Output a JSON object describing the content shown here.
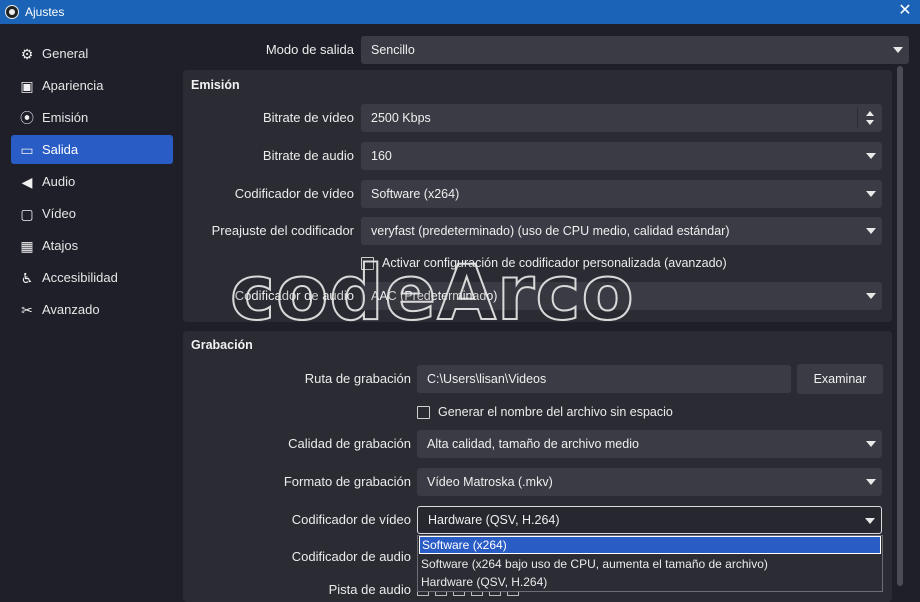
{
  "window": {
    "title": "Ajustes"
  },
  "sidebar": {
    "items": [
      {
        "label": "General",
        "icon": "gear-icon"
      },
      {
        "label": "Apariencia",
        "icon": "appearance-icon"
      },
      {
        "label": "Emisión",
        "icon": "broadcast-icon"
      },
      {
        "label": "Salida",
        "icon": "output-icon",
        "active": true
      },
      {
        "label": "Audio",
        "icon": "speaker-icon"
      },
      {
        "label": "Vídeo",
        "icon": "monitor-icon"
      },
      {
        "label": "Atajos",
        "icon": "keyboard-icon"
      },
      {
        "label": "Accesibilidad",
        "icon": "accessibility-icon"
      },
      {
        "label": "Avanzado",
        "icon": "tools-icon"
      }
    ]
  },
  "output_mode": {
    "label": "Modo de salida",
    "value": "Sencillo"
  },
  "streaming": {
    "title": "Emisión",
    "video_bitrate": {
      "label": "Bitrate de vídeo",
      "value": "2500 Kbps"
    },
    "audio_bitrate": {
      "label": "Bitrate de audio",
      "value": "160"
    },
    "video_encoder": {
      "label": "Codificador de vídeo",
      "value": "Software (x264)"
    },
    "encoder_preset": {
      "label": "Preajuste del codificador",
      "value": "veryfast (predeterminado) (uso de CPU medio, calidad estándar)"
    },
    "custom_encoder_checkbox": "Activar configuración de codificador personalizada (avanzado)",
    "audio_encoder": {
      "label": "Codificador de audio",
      "value": "AAC (Predeterminado)"
    }
  },
  "recording": {
    "title": "Grabación",
    "path": {
      "label": "Ruta de grabación",
      "value": "C:\\Users\\lisan\\Videos",
      "browse_label": "Examinar"
    },
    "no_space_checkbox": "Generar el nombre del archivo sin espacio",
    "quality": {
      "label": "Calidad de grabación",
      "value": "Alta calidad, tamaño de archivo medio"
    },
    "format": {
      "label": "Formato de grabación",
      "value": "Vídeo Matroska (.mkv)"
    },
    "video_encoder": {
      "label": "Codificador de vídeo",
      "value": "Hardware (QSV, H.264)",
      "options": [
        "Software (x264)",
        "Software (x264 bajo uso de CPU, aumenta el tamaño de archivo)",
        "Hardware (QSV, H.264)"
      ]
    },
    "audio_encoder": {
      "label": "Codificador de audio"
    },
    "audio_track": {
      "label": "Pista de audio"
    }
  },
  "watermark": "codeArco",
  "colors": {
    "accent": "#2a5cc6",
    "titlebar": "#1a63b6",
    "background": "#1e1f29",
    "panel": "#2a2b33",
    "field": "#3a3b44"
  }
}
